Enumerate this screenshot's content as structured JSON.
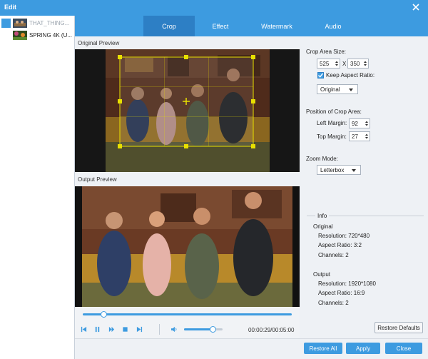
{
  "window": {
    "title": "Edit"
  },
  "files": [
    {
      "name": "THAT_THING...",
      "dim": true
    },
    {
      "name": "SPRING 4K (U...",
      "dim": false
    }
  ],
  "tabs": [
    {
      "label": "Crop",
      "active": true
    },
    {
      "label": "Effect",
      "active": false
    },
    {
      "label": "Watermark",
      "active": false
    },
    {
      "label": "Audio",
      "active": false
    }
  ],
  "preview": {
    "original_label": "Original Preview",
    "output_label": "Output Preview"
  },
  "player": {
    "progress": 0.1,
    "volume": 0.75,
    "time": "00:00:29/00:05:00"
  },
  "crop": {
    "area_size_label": "Crop Area Size:",
    "width": "525",
    "x_label": "X",
    "height": "350",
    "keep_aspect_label": "Keep Aspect Ratio:",
    "keep_aspect_checked": true,
    "aspect_option": "Original",
    "position_label": "Position of Crop Area:",
    "left_margin_label": "Left Margin:",
    "left_margin": "92",
    "top_margin_label": "Top Margin:",
    "top_margin": "27",
    "zoom_label": "Zoom Mode:",
    "zoom_option": "Letterbox"
  },
  "info": {
    "title": "Info",
    "original_heading": "Original",
    "original_resolution": "Resolution: 720*480",
    "original_aspect": "Aspect Ratio: 3:2",
    "original_channels": "Channels: 2",
    "output_heading": "Output",
    "output_resolution": "Resolution: 1920*1080",
    "output_aspect": "Aspect Ratio: 16:9",
    "output_channels": "Channels: 2"
  },
  "buttons": {
    "restore_defaults": "Restore Defaults",
    "restore_all": "Restore All",
    "apply": "Apply",
    "close": "Close"
  },
  "colors": {
    "accent": "#3d9be0",
    "crop_frame": "#e8e000"
  }
}
